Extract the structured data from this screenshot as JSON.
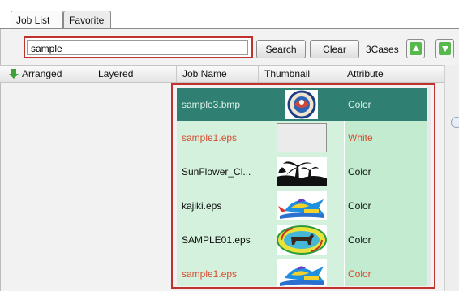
{
  "tabs": [
    {
      "label": "Job List",
      "active": true
    },
    {
      "label": "Favorite",
      "active": false
    }
  ],
  "search": {
    "value": "sample",
    "placeholder": ""
  },
  "buttons": {
    "search": "Search",
    "clear": "Clear"
  },
  "count_label": "3Cases",
  "icons": {
    "move_up": "arrow-up-green-icon",
    "move_down": "arrow-down-green-icon",
    "sort": "arrow-down-green-icon"
  },
  "columns": [
    "Arranged",
    "Layered",
    "Job Name",
    "Thumbnail",
    "Attribute"
  ],
  "rows": [
    {
      "job_name": "sample3.bmp",
      "attribute": "Color",
      "thumbnail": "round logo image",
      "selected": true
    },
    {
      "job_name": "sample1.eps",
      "attribute": "White",
      "thumbnail": "blank gray image",
      "selected": false
    },
    {
      "job_name": "SunFlower_Cl...",
      "attribute": "Color",
      "thumbnail": "palm tree silhouette",
      "selected": false
    },
    {
      "job_name": "kajiki.eps",
      "attribute": "Color",
      "thumbnail": "marlin fish logo",
      "selected": false
    },
    {
      "job_name": "SAMPLE01.eps",
      "attribute": "Color",
      "thumbnail": "dog oval emblem",
      "selected": false
    },
    {
      "job_name": "sample1.eps",
      "attribute": "Color",
      "thumbnail": "marlin fish logo",
      "selected": false
    }
  ],
  "colors": {
    "selected_row": "#2f8072",
    "row_bg": "#d4f1dd",
    "white_attr_text": "#d84a31",
    "highlight": "#c0322e"
  }
}
